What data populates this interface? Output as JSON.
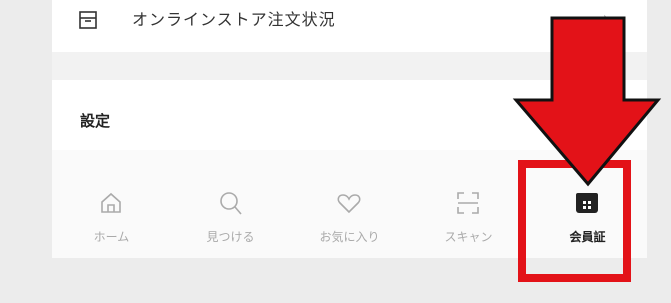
{
  "order_row": {
    "label": "オンラインストア注文状況",
    "icon": "box-icon"
  },
  "settings": {
    "label": "設定"
  },
  "tabs": [
    {
      "label": "ホーム",
      "icon": "home-icon"
    },
    {
      "label": "見つける",
      "icon": "search-icon"
    },
    {
      "label": "お気に入り",
      "icon": "heart-icon"
    },
    {
      "label": "スキャン",
      "icon": "scan-icon"
    },
    {
      "label": "会員証",
      "icon": "member-card-icon"
    }
  ],
  "colors": {
    "highlight": "#e31218",
    "active_text": "#222222",
    "inactive_text": "#aaaaaa"
  }
}
